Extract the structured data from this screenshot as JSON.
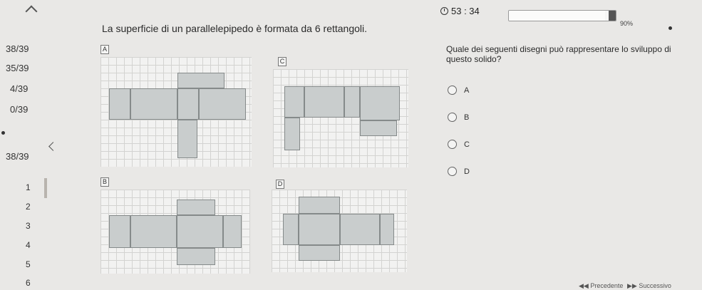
{
  "sidebar": {
    "stats": [
      "38/39",
      "35/39",
      "4/39",
      "0/39",
      "38/39"
    ],
    "question_numbers": [
      "1",
      "2",
      "3",
      "4",
      "5",
      "6"
    ]
  },
  "header": {
    "timer": "53 : 34",
    "progress_label": "90%",
    "progress_value": 0.9
  },
  "question": {
    "text": "La superficie di un parallelepipedo è formata da 6 rettangoli.",
    "prompt": "Quale dei seguenti disegni può rappresentare lo sviluppo di questo solido?"
  },
  "figures": {
    "labels": [
      "A",
      "B",
      "C",
      "D"
    ]
  },
  "options": [
    {
      "label": "A"
    },
    {
      "label": "B"
    },
    {
      "label": "C"
    },
    {
      "label": "D"
    }
  ],
  "nav": {
    "prev": "◀◀ Precedente",
    "next": "▶▶ Successivo"
  }
}
